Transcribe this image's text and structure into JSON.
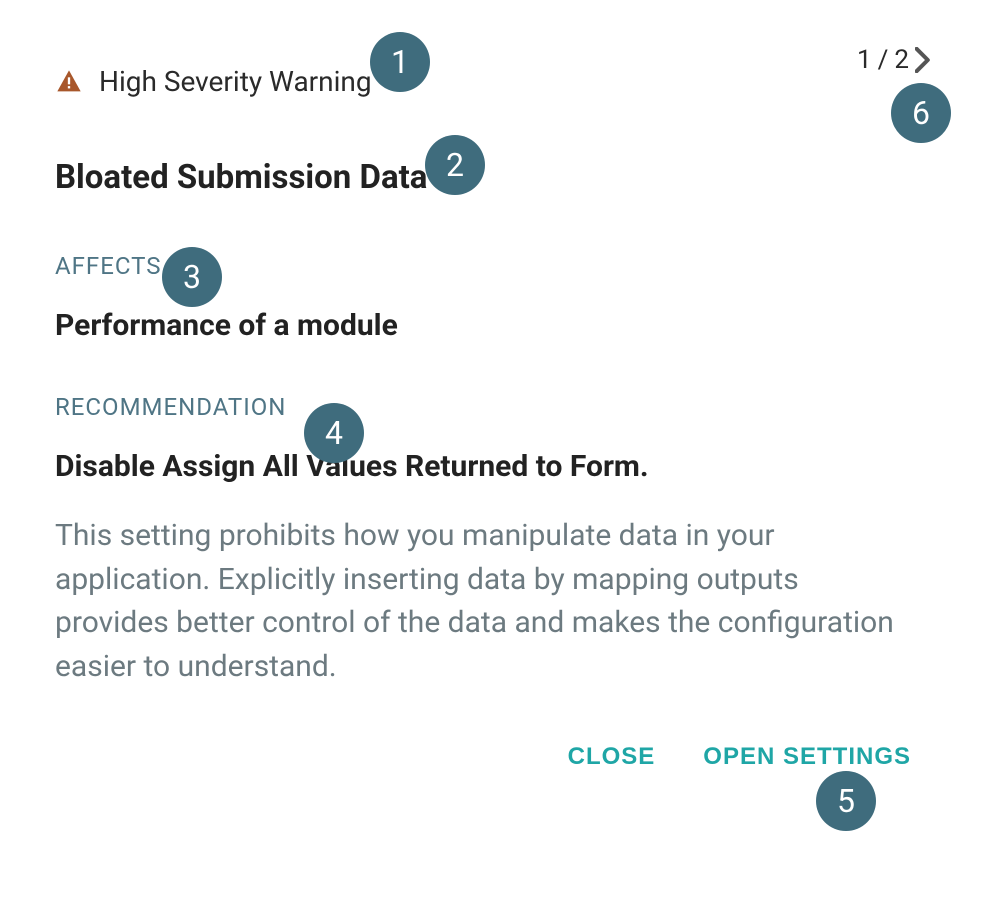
{
  "header": {
    "severity_label": "High Severity Warning",
    "page_current": "1",
    "page_total": "2"
  },
  "title": "Bloated Submission Data",
  "sections": {
    "affects": {
      "label": "AFFECTS",
      "value": "Performance of a module"
    },
    "recommendation": {
      "label": "RECOMMENDATION",
      "value": "Disable Assign All Values Returned to Form."
    }
  },
  "description": "This setting prohibits how you manipulate data in your application. Explicitly inserting data by mapping outputs provides better control of the data and makes the configuration easier to understand.",
  "actions": {
    "close": "CLOSE",
    "open_settings": "OPEN SETTINGS"
  },
  "callouts": {
    "c1": "1",
    "c2": "2",
    "c3": "3",
    "c4": "4",
    "c5": "5",
    "c6": "6"
  },
  "colors": {
    "warning_icon": "#a8572b",
    "section_label": "#4f7585",
    "action": "#1fa6a6",
    "callout_bg": "#3f6c7d"
  }
}
